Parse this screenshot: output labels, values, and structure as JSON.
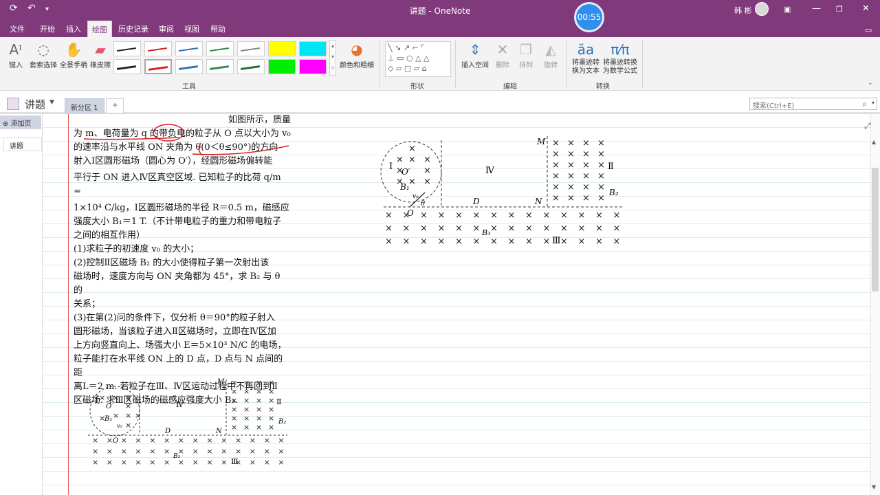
{
  "titlebar": {
    "title": "讲题 - OneNote",
    "timer": "00:55",
    "user": "韩 彬"
  },
  "menu": {
    "items": [
      "文件",
      "开始",
      "插入",
      "绘图",
      "历史记录",
      "审阅",
      "视图",
      "帮助"
    ],
    "active": "绘图"
  },
  "ribbon": {
    "tools": [
      "键入",
      "套索选择",
      "全景手柄",
      "橡皮擦"
    ],
    "tools_group": "工具",
    "color_thickness": "颜色和粗细",
    "shapes_group": "形状",
    "insert_space": "插入空间",
    "delete": "删除",
    "arrange": "排列",
    "rotate": "旋转",
    "edit_group": "编辑",
    "ink_to_text": "将墨迹转\n换为文本",
    "ink_to_math": "将墨迹转换\n为数学公式",
    "convert_group": "转换"
  },
  "notebook": {
    "name": "讲题",
    "section_tab": "新分区 1",
    "add_tab": "+",
    "search_placeholder": "搜索(Ctrl+E)"
  },
  "pages": {
    "add_page": "添加页",
    "items": [
      "讲题"
    ]
  },
  "problem": {
    "lines": [
      "如图所示，质量",
      "为 m、电荷量为 q 的带负电的粒子从 O 点以大小为 v₀",
      "的速率沿与水平线 ON 夹角为 θ(0＜θ≤90°)的方向",
      "射入Ⅰ区圆形磁场（圆心为 O′），经圆形磁场偏转能",
      "平行于 ON 进入Ⅳ区真空区域. 已知粒子的比荷 q/m =",
      "1×10⁴ C/kg，Ⅰ区圆形磁场的半径 R＝0.5 m，磁感应",
      "强度大小 B₁＝1 T.（不计带电粒子的重力和带电粒子",
      "之间的相互作用）",
      "(1)求粒子的初速度 v₀ 的大小；",
      "(2)控制Ⅱ区磁场 B₂ 的大小使得粒子第一次射出该",
      "磁场时，速度方向与 ON 夹角都为 45°，求 B₂ 与 θ 的",
      "关系；",
      "(3)在第(2)问的条件下，仅分析 θ＝90°的粒子射入",
      "圆形磁场，当该粒子进入Ⅱ区磁场时，立即在Ⅳ区加",
      "上方向竖直向上、场强大小 E＝5×10³ N/C 的电场，",
      "粒子能打在水平线 ON 上的 D 点，D 点与 N 点间的距",
      "离L＝2 m. 若粒子在Ⅲ、Ⅳ区运动过程中不再回到Ⅱ",
      "区磁场. 求Ⅲ区磁场的磁感应强度大小 B₃."
    ]
  },
  "diagram": {
    "labels": {
      "r1": "Ⅰ",
      "r2": "Ⅱ",
      "r3": "Ⅲ",
      "r4": "Ⅳ",
      "o_prime": "O′",
      "o": "O",
      "b1": "B₁",
      "b2": "B₂",
      "b3": "B₃",
      "v0": "v₀",
      "theta": "θ",
      "d": "D",
      "n": "N",
      "m": "M"
    }
  },
  "colors": {
    "accent": "#80397b",
    "ink_red": "#d61f26"
  }
}
